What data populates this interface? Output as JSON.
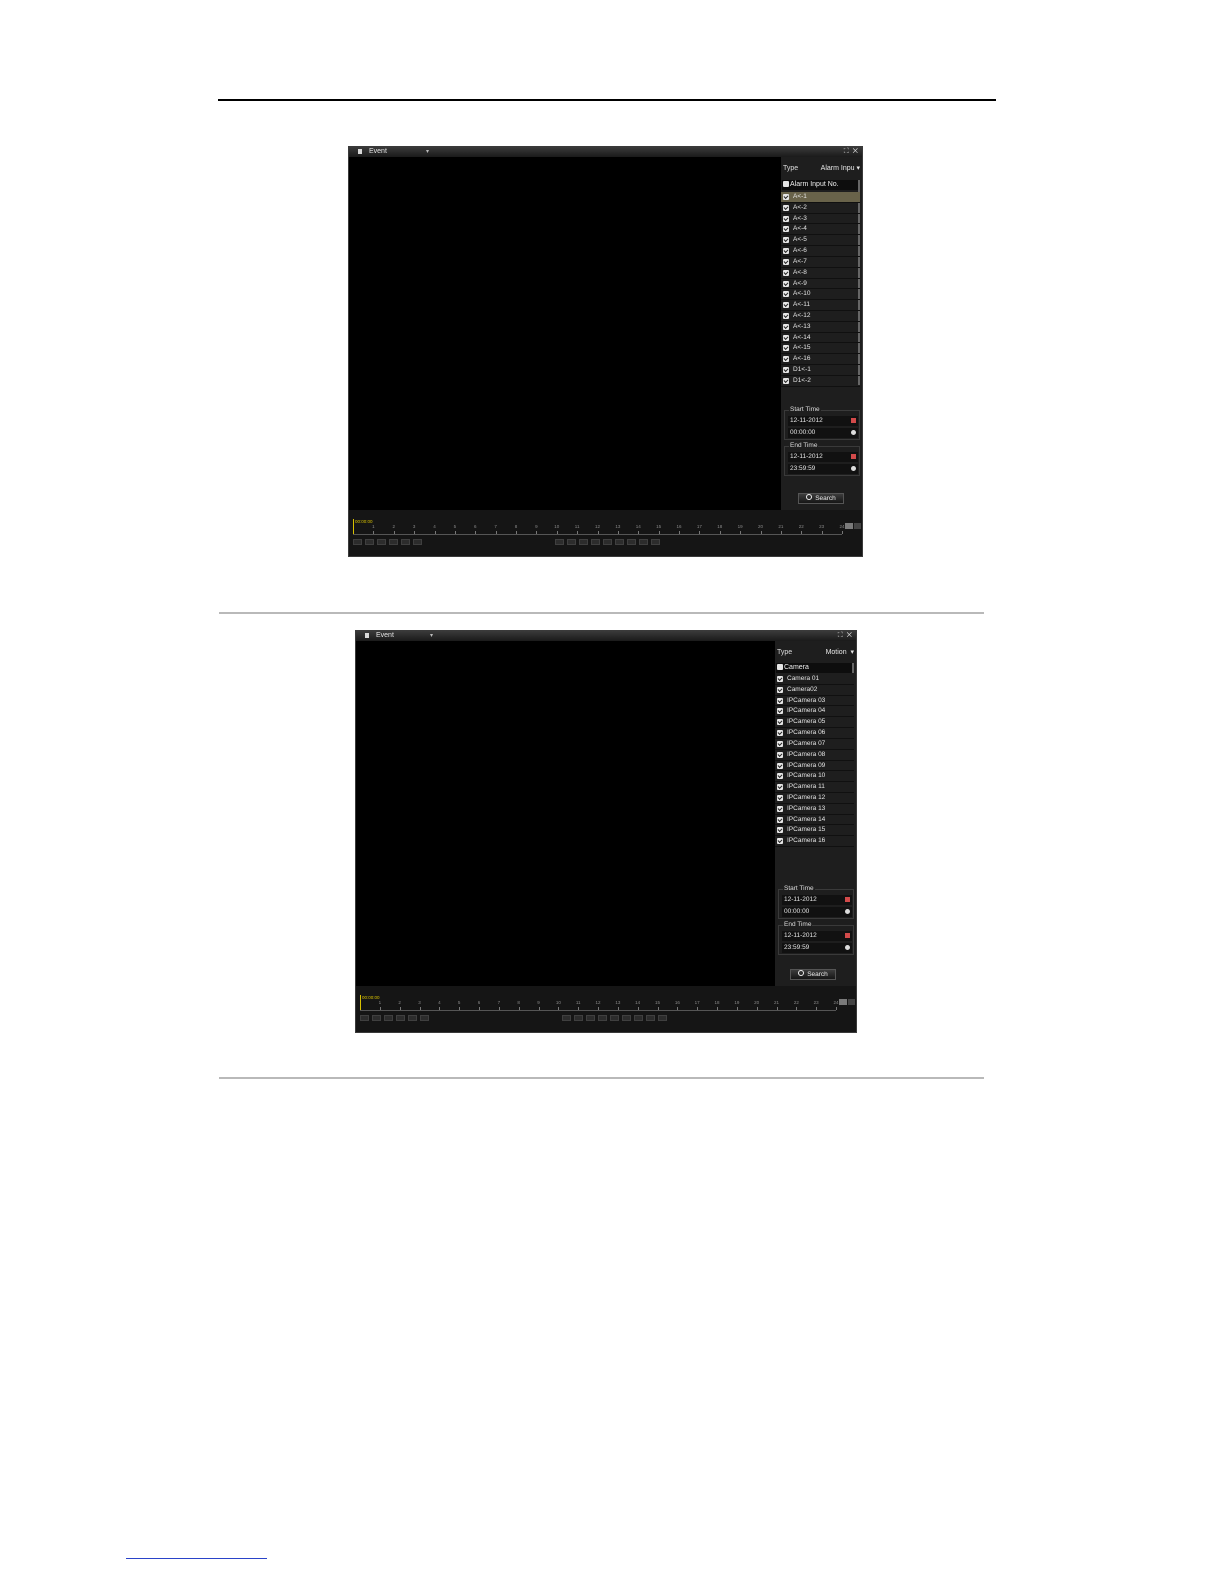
{
  "windows": [
    {
      "title": "Event",
      "type_label": "Type",
      "type_value": "Alarm Inpu",
      "list_header": "Alarm Input No.",
      "items": [
        "A<-1",
        "A<-2",
        "A<-3",
        "A<-4",
        "A<-5",
        "A<-6",
        "A<-7",
        "A<-8",
        "A<-9",
        "A<-10",
        "A<-11",
        "A<-12",
        "A<-13",
        "A<-14",
        "A<-15",
        "A<-16",
        "D1<-1",
        "D1<-2"
      ],
      "selected_index": 0,
      "start_time": {
        "label": "Start Time",
        "date": "12-11-2012",
        "time": "00:00:00"
      },
      "end_time": {
        "label": "End Time",
        "date": "12-11-2012",
        "time": "23:59:59"
      },
      "search_label": "Search",
      "timeline_time": "00:00:00",
      "hours": [
        "1",
        "2",
        "3",
        "4",
        "5",
        "6",
        "7",
        "8",
        "9",
        "10",
        "11",
        "12",
        "13",
        "14",
        "15",
        "16",
        "17",
        "18",
        "19",
        "20",
        "21",
        "22",
        "23",
        "24"
      ]
    },
    {
      "title": "Event",
      "type_label": "Type",
      "type_value": "Motion",
      "list_header": "Camera",
      "items": [
        "Camera 01",
        "Camera02",
        "IPCamera 03",
        "IPCamera 04",
        "IPCamera 05",
        "IPCamera 06",
        "IPCamera 07",
        "IPCamera 08",
        "IPCamera 09",
        "IPCamera 10",
        "IPCamera 11",
        "IPCamera 12",
        "IPCamera 13",
        "IPCamera 14",
        "IPCamera 15",
        "IPCamera 16"
      ],
      "selected_index": -1,
      "start_time": {
        "label": "Start Time",
        "date": "12-11-2012",
        "time": "00:00:00"
      },
      "end_time": {
        "label": "End Time",
        "date": "12-11-2012",
        "time": "23:59:59"
      },
      "search_label": "Search",
      "timeline_time": "00:00:00",
      "hours": [
        "1",
        "2",
        "3",
        "4",
        "5",
        "6",
        "7",
        "8",
        "9",
        "10",
        "11",
        "12",
        "13",
        "14",
        "15",
        "16",
        "17",
        "18",
        "19",
        "20",
        "21",
        "22",
        "23",
        "24"
      ]
    }
  ]
}
